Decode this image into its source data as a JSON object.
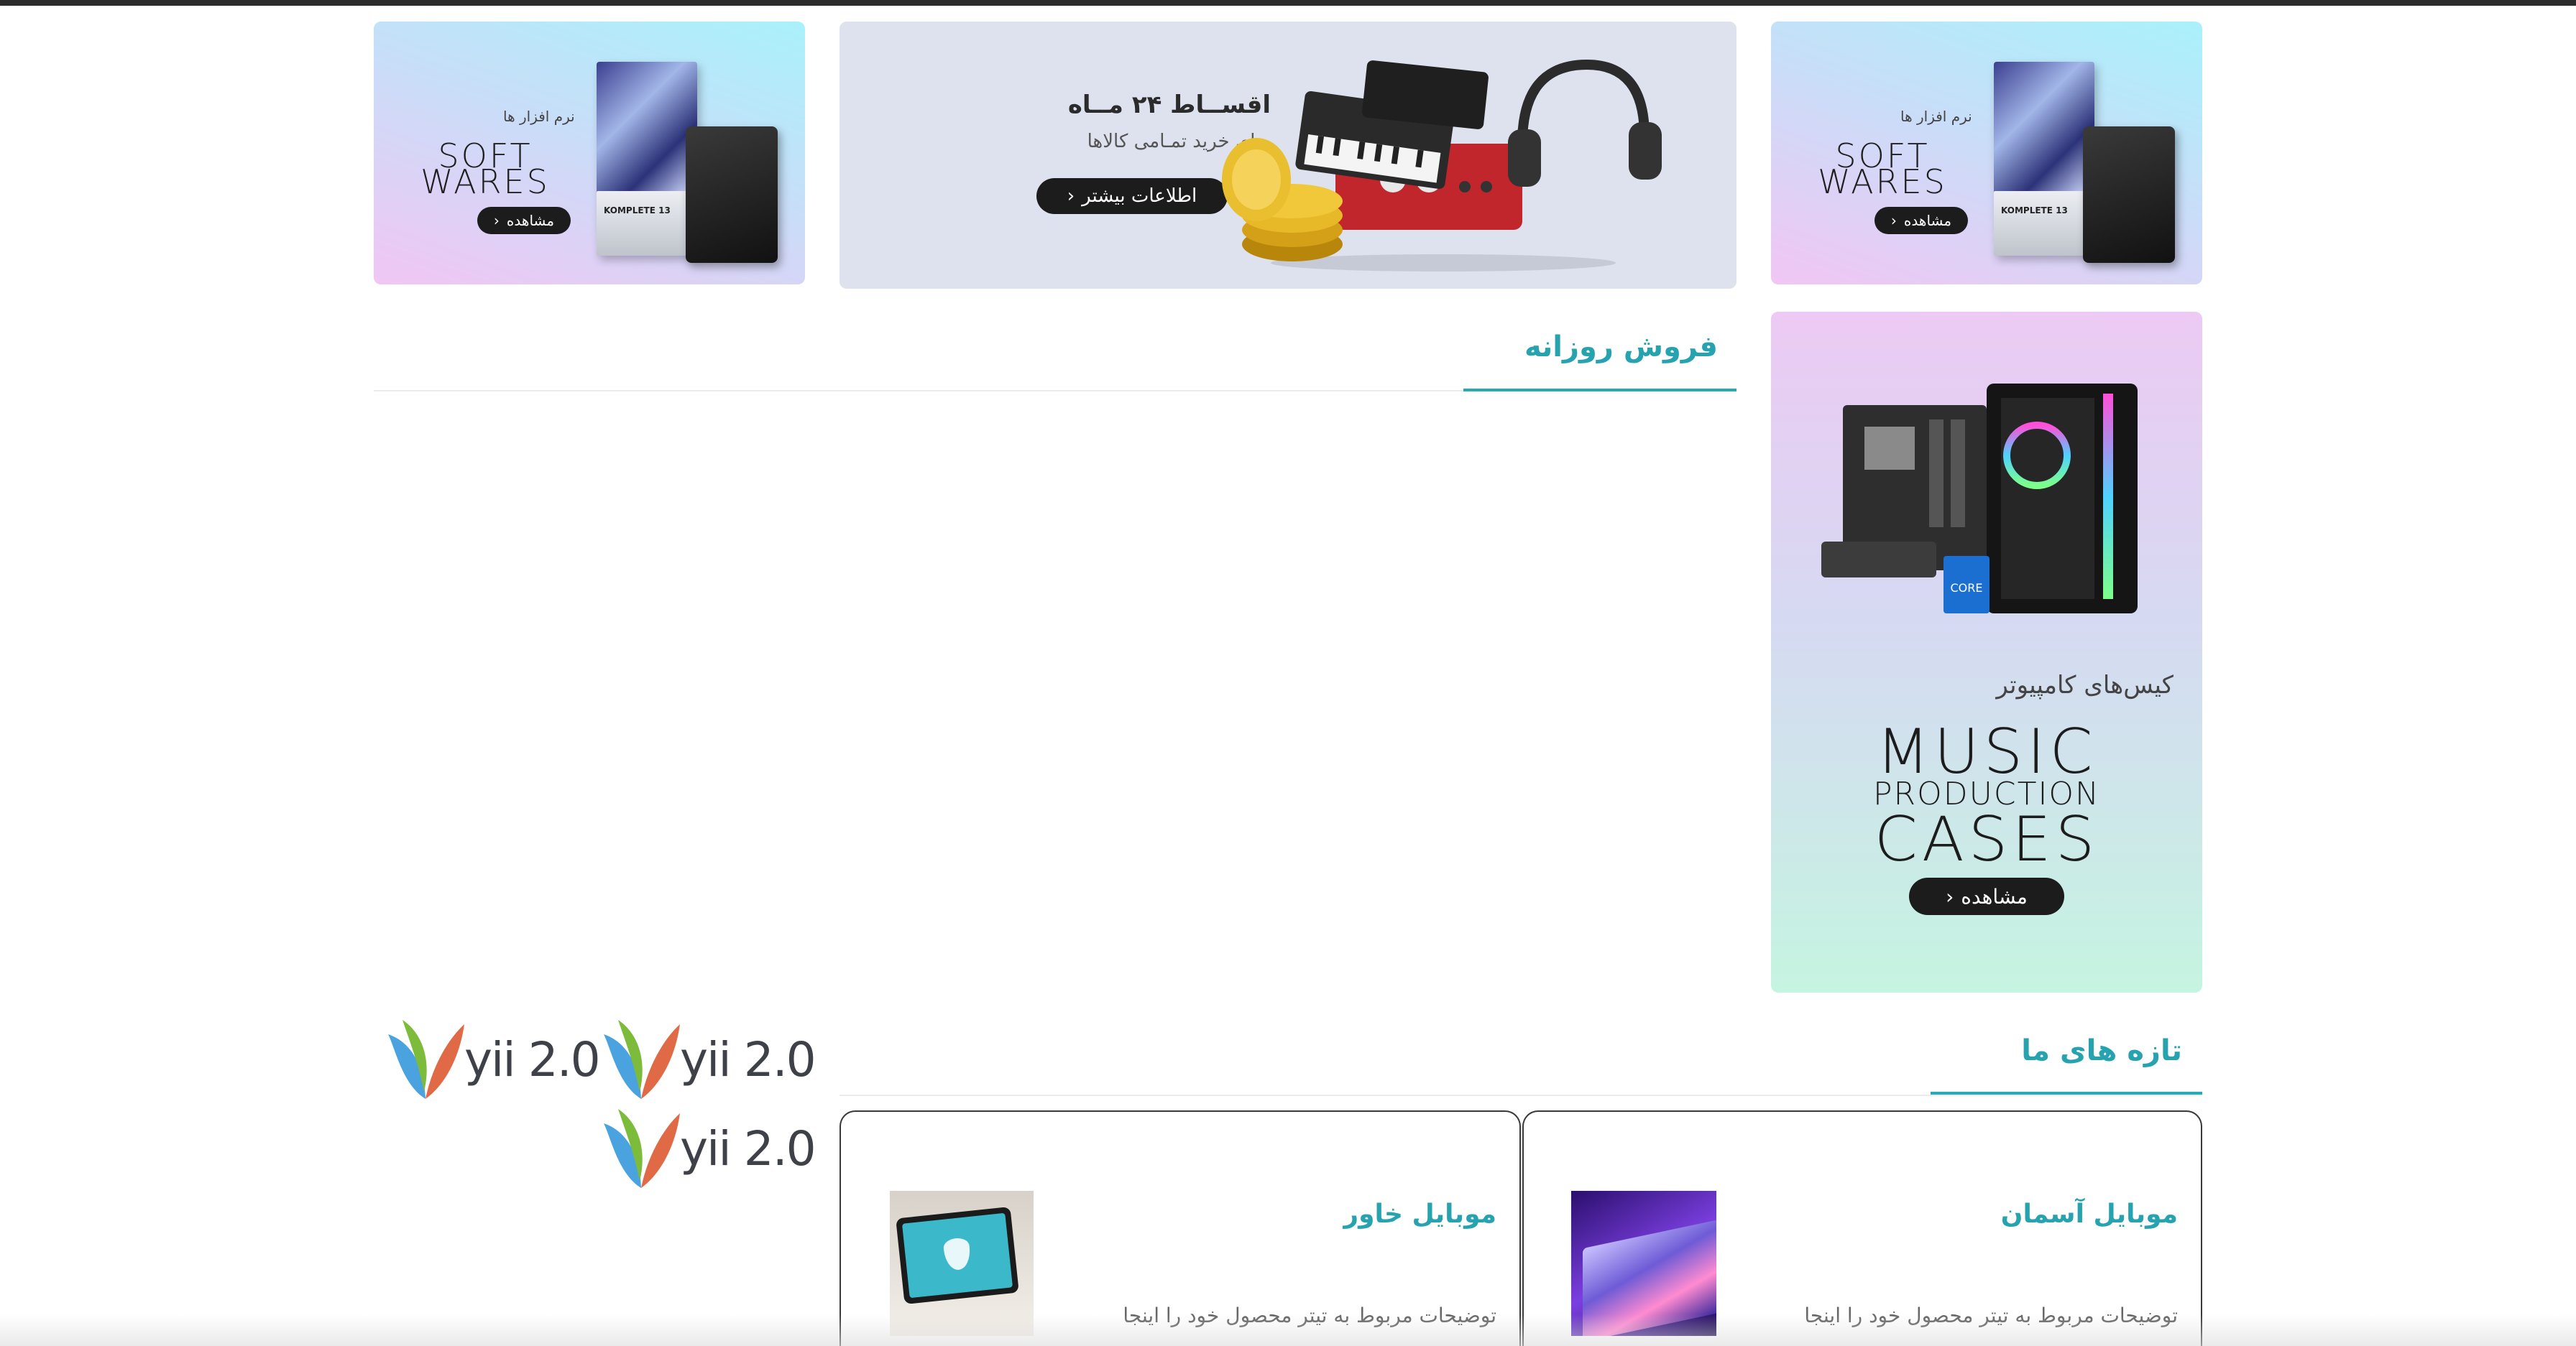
{
  "banners": {
    "software_left": {
      "tag": "نرم افزار ها",
      "word1": "SOFT",
      "word2": "WARES",
      "button": "مشاهده",
      "box_label": "KOMPLETE 13"
    },
    "software_right": {
      "tag": "نرم افزار ها",
      "word1": "SOFT",
      "word2": "WARES",
      "button": "مشاهده",
      "box_label": "KOMPLETE 13"
    },
    "installments": {
      "title": "اقســاط ۲۴ مــاه",
      "subtitle": "برای خرید تمـامی کالاها",
      "button": "اطلاعات بیشتر"
    },
    "cases": {
      "subtitle_fa": "کیس‌های کامپیوتر",
      "line1": "MUSIC",
      "line2": "PRODUCTION",
      "line3": "CASES",
      "button": "مشاهده",
      "cpu_label": "CORE"
    }
  },
  "daily_sales": {
    "title": "فروش روزانه"
  },
  "new_arrivals": {
    "title": "تازه های ما",
    "cards": [
      {
        "title": "موبایل آسمان",
        "description": "توضیحات مربوط به تیتر محصول خود را اینجا"
      },
      {
        "title": "موبایل خاور",
        "description": "توضیحات مربوط به تیتر محصول خود را اینجا"
      }
    ]
  },
  "logos": {
    "yii_text": "yii 2.0"
  },
  "icons": {
    "chevron": "chevron-left-icon"
  },
  "colors": {
    "accent": "#29a8b6",
    "dark_button": "#1c1c1c"
  }
}
